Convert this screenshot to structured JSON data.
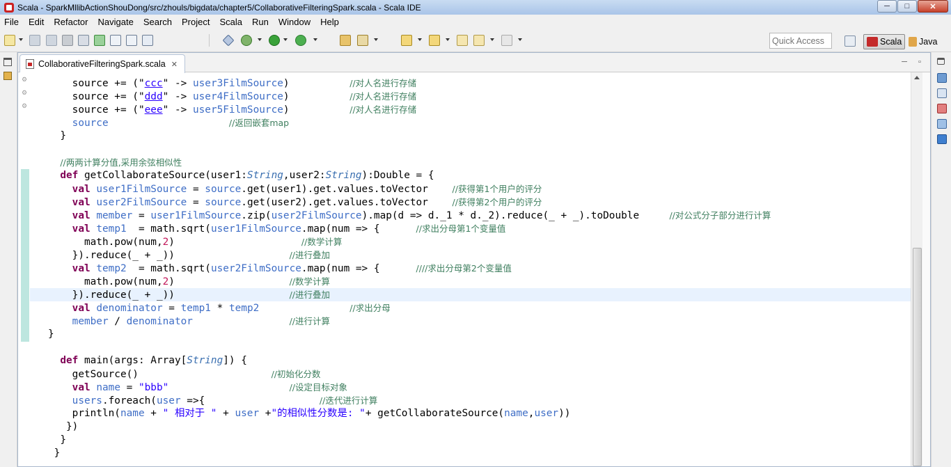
{
  "window": {
    "title": "Scala - SparkMllibActionShouDong/src/zhouls/bigdata/chapter5/CollaborativeFilteringSpark.scala - Scala IDE",
    "controls": {
      "minimize": "─",
      "maximize": "□",
      "close": "✕"
    }
  },
  "menu": [
    "File",
    "Edit",
    "Refactor",
    "Navigate",
    "Search",
    "Project",
    "Scala",
    "Run",
    "Window",
    "Help"
  ],
  "toolbar": {
    "quick_access_placeholder": "Quick Access",
    "perspectives": [
      {
        "label": "Scala",
        "active": true
      },
      {
        "label": "Java",
        "active": false
      }
    ]
  },
  "editor": {
    "tab_label": "CollaborativeFilteringSpark.scala",
    "tab_close": "✕",
    "panel_minimize": "─",
    "panel_maximize": "▫"
  },
  "code_lines": [
    [
      {
        "t": "    source += (\"",
        "c": "p"
      },
      {
        "t": "ccc",
        "c": "s u"
      },
      {
        "t": "\" -> ",
        "c": "p"
      },
      {
        "t": "user3FilmSource",
        "c": "v"
      },
      {
        "t": ")          ",
        "c": "p"
      },
      {
        "t": "//对人名进行存储",
        "c": "c"
      }
    ],
    [
      {
        "t": "    source += (\"",
        "c": "p"
      },
      {
        "t": "ddd",
        "c": "s u"
      },
      {
        "t": "\" -> ",
        "c": "p"
      },
      {
        "t": "user4FilmSource",
        "c": "v"
      },
      {
        "t": ")          ",
        "c": "p"
      },
      {
        "t": "//对人名进行存储",
        "c": "c"
      }
    ],
    [
      {
        "t": "    source += (\"",
        "c": "p"
      },
      {
        "t": "eee",
        "c": "s u"
      },
      {
        "t": "\" -> ",
        "c": "p"
      },
      {
        "t": "user5FilmSource",
        "c": "v"
      },
      {
        "t": ")          ",
        "c": "p"
      },
      {
        "t": "//对人名进行存储",
        "c": "c"
      }
    ],
    [
      {
        "t": "    source                    ",
        "c": "v"
      },
      {
        "t": "//返回嵌套map",
        "c": "c"
      }
    ],
    [
      {
        "t": "  }",
        "c": "p"
      }
    ],
    [],
    [
      {
        "t": "  ",
        "c": "p"
      },
      {
        "t": "//两两计算分值,采用余弦相似性",
        "c": "c"
      }
    ],
    [
      {
        "t": "  ",
        "c": "p"
      },
      {
        "t": "def",
        "c": "k"
      },
      {
        "t": " getCollaborateSource(user1:",
        "c": "p"
      },
      {
        "t": "String",
        "c": "t"
      },
      {
        "t": ",user2:",
        "c": "p"
      },
      {
        "t": "String",
        "c": "t"
      },
      {
        "t": "):Double = {",
        "c": "p"
      }
    ],
    [
      {
        "t": "    ",
        "c": "p"
      },
      {
        "t": "val",
        "c": "k"
      },
      {
        "t": " ",
        "c": "p"
      },
      {
        "t": "user1FilmSource",
        "c": "v"
      },
      {
        "t": " = ",
        "c": "p"
      },
      {
        "t": "source",
        "c": "v"
      },
      {
        "t": ".get(user1).get.values.toVector    ",
        "c": "p"
      },
      {
        "t": "//获得第1个用户的评分",
        "c": "c"
      }
    ],
    [
      {
        "t": "    ",
        "c": "p"
      },
      {
        "t": "val",
        "c": "k"
      },
      {
        "t": " ",
        "c": "p"
      },
      {
        "t": "user2FilmSource",
        "c": "v"
      },
      {
        "t": " = ",
        "c": "p"
      },
      {
        "t": "source",
        "c": "v"
      },
      {
        "t": ".get(user2).get.values.toVector    ",
        "c": "p"
      },
      {
        "t": "//获得第2个用户的评分",
        "c": "c"
      }
    ],
    [
      {
        "t": "    ",
        "c": "p"
      },
      {
        "t": "val",
        "c": "k"
      },
      {
        "t": " ",
        "c": "p"
      },
      {
        "t": "member",
        "c": "v"
      },
      {
        "t": " = ",
        "c": "p"
      },
      {
        "t": "user1FilmSource",
        "c": "v"
      },
      {
        "t": ".zip(",
        "c": "p"
      },
      {
        "t": "user2FilmSource",
        "c": "v"
      },
      {
        "t": ").map(d => d._1 * d._2).reduce(_ + _).toDouble     ",
        "c": "p"
      },
      {
        "t": "//对公式分子部分进行计算",
        "c": "c"
      }
    ],
    [
      {
        "t": "    ",
        "c": "p"
      },
      {
        "t": "val",
        "c": "k"
      },
      {
        "t": " ",
        "c": "p"
      },
      {
        "t": "temp1",
        "c": "v"
      },
      {
        "t": "  = math.sqrt(",
        "c": "p"
      },
      {
        "t": "user1FilmSource",
        "c": "v"
      },
      {
        "t": ".map(num => {      ",
        "c": "p"
      },
      {
        "t": "//求出分母第1个变量值",
        "c": "c"
      }
    ],
    [
      {
        "t": "      math.pow(num,",
        "c": "p"
      },
      {
        "t": "2",
        "c": "n"
      },
      {
        "t": ")                     ",
        "c": "p"
      },
      {
        "t": "//数学计算",
        "c": "c"
      }
    ],
    [
      {
        "t": "    }).reduce(_ + _))                   ",
        "c": "p"
      },
      {
        "t": "//进行叠加",
        "c": "c"
      }
    ],
    [
      {
        "t": "    ",
        "c": "p"
      },
      {
        "t": "val",
        "c": "k"
      },
      {
        "t": " ",
        "c": "p"
      },
      {
        "t": "temp2",
        "c": "v"
      },
      {
        "t": "  = math.sqrt(",
        "c": "p"
      },
      {
        "t": "user2FilmSource",
        "c": "v"
      },
      {
        "t": ".map(num => {      ",
        "c": "p"
      },
      {
        "t": "////求出分母第2个变量值",
        "c": "c"
      }
    ],
    [
      {
        "t": "      math.pow(num,",
        "c": "p"
      },
      {
        "t": "2",
        "c": "n"
      },
      {
        "t": ")                   ",
        "c": "p"
      },
      {
        "t": "//数学计算",
        "c": "c"
      }
    ],
    [
      {
        "t": "    }).reduce(_ + _))                   ",
        "c": "p"
      },
      {
        "t": "//进行叠加",
        "c": "c"
      }
    ],
    [
      {
        "t": "    ",
        "c": "p"
      },
      {
        "t": "val",
        "c": "k"
      },
      {
        "t": " ",
        "c": "p"
      },
      {
        "t": "denominator",
        "c": "v"
      },
      {
        "t": " = ",
        "c": "p"
      },
      {
        "t": "temp1",
        "c": "v"
      },
      {
        "t": " * ",
        "c": "p"
      },
      {
        "t": "temp2",
        "c": "v"
      },
      {
        "t": "               ",
        "c": "p"
      },
      {
        "t": "//求出分母",
        "c": "c"
      }
    ],
    [
      {
        "t": "    ",
        "c": "p"
      },
      {
        "t": "member",
        "c": "v"
      },
      {
        "t": " / ",
        "c": "p"
      },
      {
        "t": "denominator",
        "c": "v"
      },
      {
        "t": "                ",
        "c": "p"
      },
      {
        "t": "//进行计算",
        "c": "c"
      }
    ],
    [
      {
        "t": "}",
        "c": "p"
      }
    ],
    [],
    [
      {
        "t": "  ",
        "c": "p"
      },
      {
        "t": "def",
        "c": "k"
      },
      {
        "t": " main(args: Array[",
        "c": "p"
      },
      {
        "t": "String",
        "c": "t"
      },
      {
        "t": "]) {",
        "c": "p"
      }
    ],
    [
      {
        "t": "    getSource()                      ",
        "c": "p"
      },
      {
        "t": "//初始化分数",
        "c": "c"
      }
    ],
    [
      {
        "t": "    ",
        "c": "p"
      },
      {
        "t": "val",
        "c": "k"
      },
      {
        "t": " ",
        "c": "p"
      },
      {
        "t": "name",
        "c": "v"
      },
      {
        "t": " = ",
        "c": "p"
      },
      {
        "t": "\"bbb\"",
        "c": "s"
      },
      {
        "t": "                    ",
        "c": "p"
      },
      {
        "t": "//设定目标对象",
        "c": "c"
      }
    ],
    [
      {
        "t": "    ",
        "c": "p"
      },
      {
        "t": "users",
        "c": "v"
      },
      {
        "t": ".foreach(",
        "c": "p"
      },
      {
        "t": "user",
        "c": "v"
      },
      {
        "t": " =>{                   ",
        "c": "p"
      },
      {
        "t": "//迭代进行计算",
        "c": "c"
      }
    ],
    [
      {
        "t": "    println(",
        "c": "p"
      },
      {
        "t": "name",
        "c": "v"
      },
      {
        "t": " + ",
        "c": "p"
      },
      {
        "t": "\" 相对于 \"",
        "c": "s"
      },
      {
        "t": " + ",
        "c": "p"
      },
      {
        "t": "user",
        "c": "v"
      },
      {
        "t": " +",
        "c": "p"
      },
      {
        "t": "\"的相似性分数是: \"",
        "c": "s"
      },
      {
        "t": "+ getCollaborateSource(",
        "c": "p"
      },
      {
        "t": "name",
        "c": "v"
      },
      {
        "t": ",",
        "c": "p"
      },
      {
        "t": "user",
        "c": "v"
      },
      {
        "t": "))",
        "c": "p"
      }
    ],
    [
      {
        "t": "   })",
        "c": "p"
      }
    ],
    [
      {
        "t": "  }",
        "c": "p"
      }
    ],
    [
      {
        "t": " }",
        "c": "p"
      }
    ]
  ],
  "current_line_index": 16
}
